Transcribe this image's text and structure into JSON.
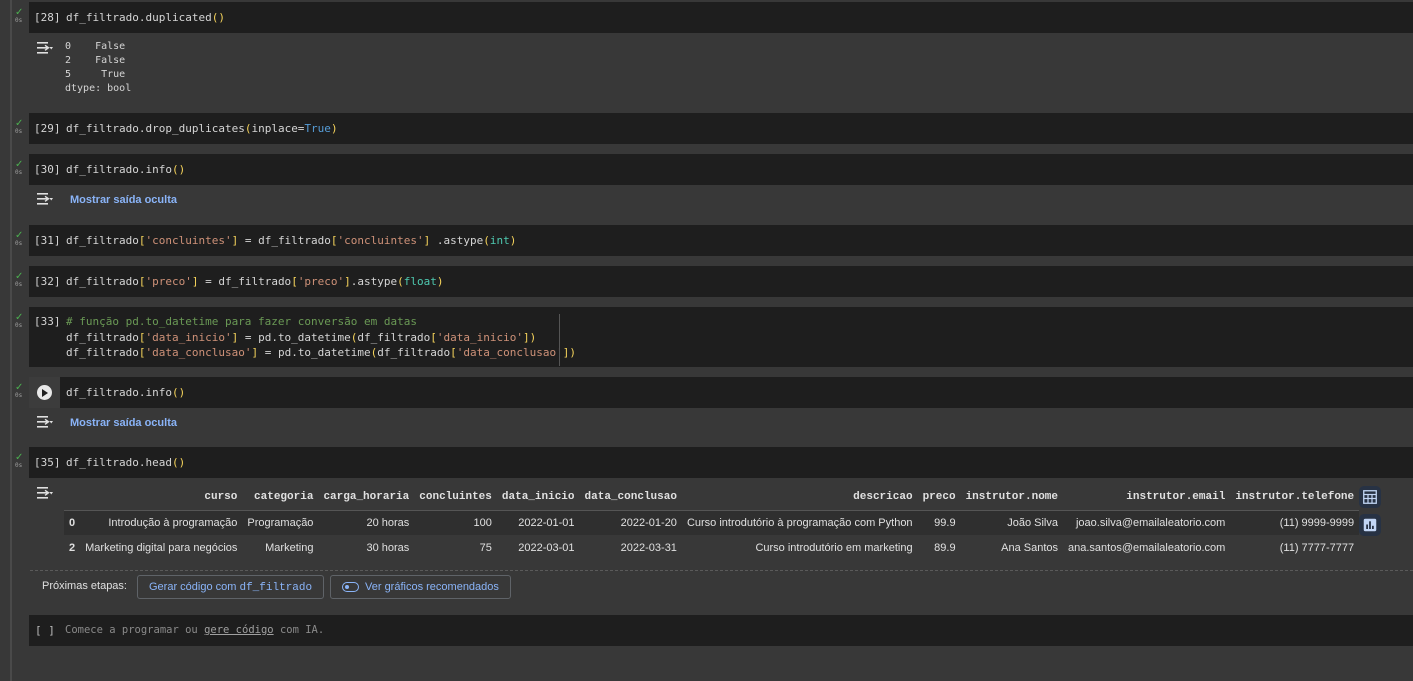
{
  "cells": {
    "c28": {
      "exec": "[28]",
      "code": {
        "obj": "df_filtrado",
        "dot": ".",
        "fn": "duplicated",
        "open": "(",
        "close": ")"
      },
      "output": {
        "lines": [
          "0    False",
          "2    False",
          "5     True",
          "dtype: bool"
        ]
      }
    },
    "c29": {
      "exec": "[29]",
      "code": {
        "obj": "df_filtrado",
        "dot": ".",
        "fn": "drop_duplicates",
        "open": "(",
        "arg": "inplace=",
        "kw": "True",
        "close": ")"
      }
    },
    "c30": {
      "exec": "[30]",
      "code": {
        "obj": "df_filtrado",
        "dot": ".",
        "fn": "info",
        "open": "(",
        "close": ")"
      },
      "hidden_output": "Mostrar saída oculta"
    },
    "c31": {
      "exec": "[31]",
      "code": {
        "p1": "df_filtrado",
        "b1": "[",
        "s1": "'concluintes'",
        "b2": "]",
        "eq": " = df_filtrado",
        "b3": "[",
        "s2": "'concluintes'",
        "b4": "]",
        "rest": " .astype",
        "open": "(",
        "builtin": "int",
        "close": ")"
      }
    },
    "c32": {
      "exec": "[32]",
      "code": {
        "p1": "df_filtrado",
        "b1": "[",
        "s1": "'preco'",
        "b2": "]",
        "eq": " = df_filtrado",
        "b3": "[",
        "s2": "'preco'",
        "b4": "]",
        "rest": ".astype",
        "open": "(",
        "builtin": "float",
        "close": ")"
      }
    },
    "c33": {
      "exec": "[33]",
      "comment": "# função pd.to_datetime para fazer conversão em datas",
      "line2": {
        "p1": "df_filtrado",
        "b1": "[",
        "s1": "'data_inicio'",
        "b2": "]",
        "eq": " = pd.to_datetime",
        "o": "(",
        "p2": "df_filtrado",
        "b3": "[",
        "s2": "'data_inicio'",
        "b4": "]",
        "c": ")"
      },
      "line3": {
        "p1": "df_filtrado",
        "b1": "[",
        "s1": "'data_conclusao'",
        "b2": "]",
        "eq": " = pd.to_datetime",
        "o": "(",
        "p2": "df_filtrado",
        "b3": "[",
        "s2": "'data_conclusao'",
        "b4": "]",
        "c": ")"
      }
    },
    "c34": {
      "code": {
        "obj": "df_filtrado",
        "dot": ".",
        "fn": "info",
        "open": "(",
        "close": ")"
      },
      "hidden_output": "Mostrar saída oculta"
    },
    "c35": {
      "exec": "[35]",
      "code": {
        "obj": "df_filtrado",
        "dot": ".",
        "fn": "head",
        "open": "(",
        "close": ")"
      }
    }
  },
  "dataframe": {
    "columns": [
      "",
      "curso",
      "categoria",
      "carga_horaria",
      "concluintes",
      "data_inicio",
      "data_conclusao",
      "descricao",
      "preco",
      "instrutor.nome",
      "instrutor.email",
      "instrutor.telefone"
    ],
    "rows": [
      [
        "0",
        "Introdução à programação",
        "Programação",
        "20 horas",
        "100",
        "2022-01-01",
        "2022-01-20",
        "Curso introdutório à programação com Python",
        "99.9",
        "João Silva",
        "joao.silva@emailaleatorio.com",
        "(11) 9999-9999"
      ],
      [
        "2",
        "Marketing digital para negócios",
        "Marketing",
        "30 horas",
        "75",
        "2022-03-01",
        "2022-03-31",
        "Curso introdutório em marketing",
        "89.9",
        "Ana Santos",
        "ana.santos@emailaleatorio.com",
        "(11) 7777-7777"
      ]
    ]
  },
  "next_steps": {
    "label": "Próximas etapas:",
    "generate_prefix": "Gerar código com ",
    "generate_var": "df_filtrado",
    "charts": "Ver gráficos recomendados"
  },
  "empty_cell": {
    "brackets": "[ ]",
    "placeholder_start": "Comece a programar ou ",
    "placeholder_link": "gere código",
    "placeholder_end": " com IA."
  },
  "icons": {
    "status": "check-icon",
    "output": "output-toggle-icon",
    "run": "play-icon",
    "table": "table-icon",
    "chart": "bar-chart-icon"
  },
  "colors": {
    "accent": "#8ab4f8",
    "success": "#4caf50",
    "string": "#ce9178",
    "paren": "#f5d35b",
    "keyword": "#569cd6",
    "builtin": "#4ec9b0",
    "comment": "#6a9955"
  }
}
